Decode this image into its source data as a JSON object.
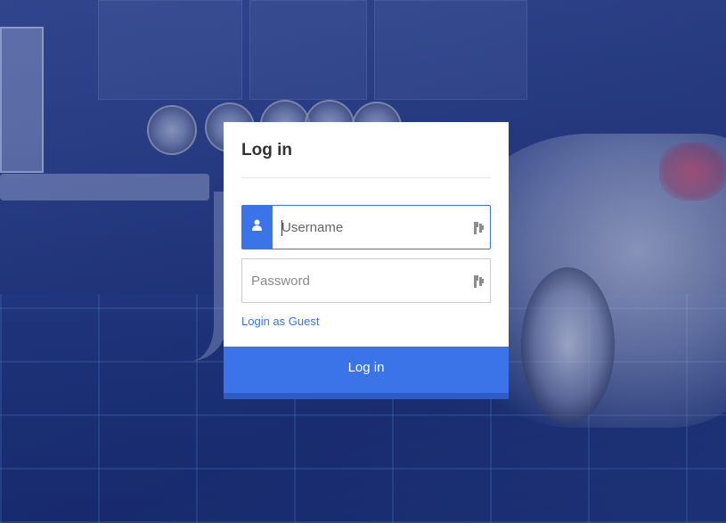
{
  "login": {
    "title": "Log in",
    "username": {
      "placeholder": "Username",
      "value": "",
      "icon": "user-icon"
    },
    "password": {
      "placeholder": "Password",
      "value": ""
    },
    "guest_link": "Login as Guest",
    "submit_label": "Log in"
  },
  "colors": {
    "accent": "#3b73e8",
    "accent_dark": "#2d5cc4",
    "background": "#1f3278"
  }
}
